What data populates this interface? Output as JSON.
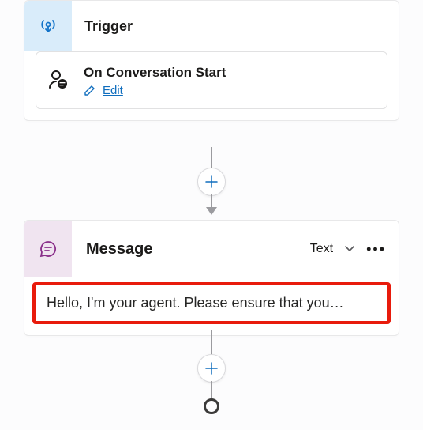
{
  "trigger": {
    "header_label": "Trigger",
    "inner": {
      "title": "On Conversation Start",
      "edit_label": "Edit"
    }
  },
  "message": {
    "header_label": "Message",
    "variant_label": "Text",
    "body_text": "Hello, I'm your agent. Please ensure that you…"
  }
}
